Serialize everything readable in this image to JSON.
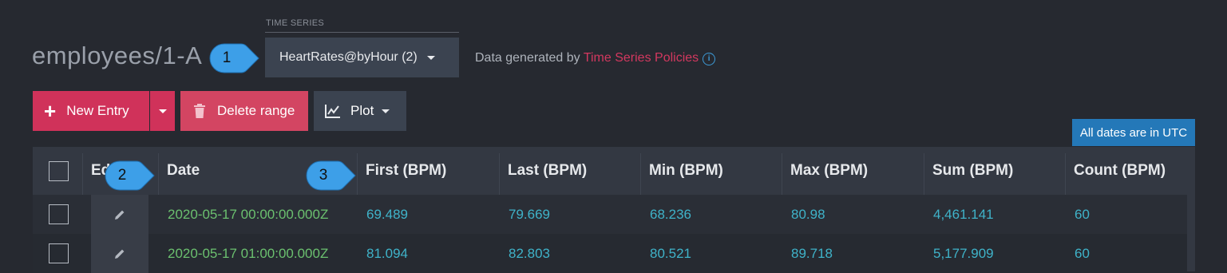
{
  "header": {
    "document_title": "employees/1-A",
    "time_series_label": "TIME SERIES",
    "time_series_selected": "HeartRates@byHour (2)",
    "info_prefix": "Data generated by ",
    "info_link": "Time Series Policies",
    "info_icon": "info-icon"
  },
  "toolbar": {
    "new_entry_label": "New Entry",
    "delete_range_label": "Delete range",
    "plot_label": "Plot"
  },
  "utc_badge": "All dates are in UTC",
  "table": {
    "columns": [
      "Ed",
      "Date",
      "First (BPM)",
      "Last (BPM)",
      "Min (BPM)",
      "Max (BPM)",
      "Sum (BPM)",
      "Count (BPM)"
    ],
    "rows": [
      {
        "date": "2020-05-17 00:00:00.000Z",
        "first": "69.489",
        "last": "79.669",
        "min": "68.236",
        "max": "80.98",
        "sum": "4,461.141",
        "count": "60"
      },
      {
        "date": "2020-05-17 01:00:00.000Z",
        "first": "81.094",
        "last": "82.803",
        "min": "80.521",
        "max": "89.718",
        "sum": "5,177.909",
        "count": "60"
      }
    ]
  },
  "callouts": [
    "1",
    "2",
    "3"
  ],
  "colors": {
    "accent": "#d0325a",
    "link": "#d3385f",
    "number": "#3fb3c9",
    "date": "#6bc06f",
    "utc_badge": "#2478b8",
    "callout": "#3d9fe8"
  }
}
